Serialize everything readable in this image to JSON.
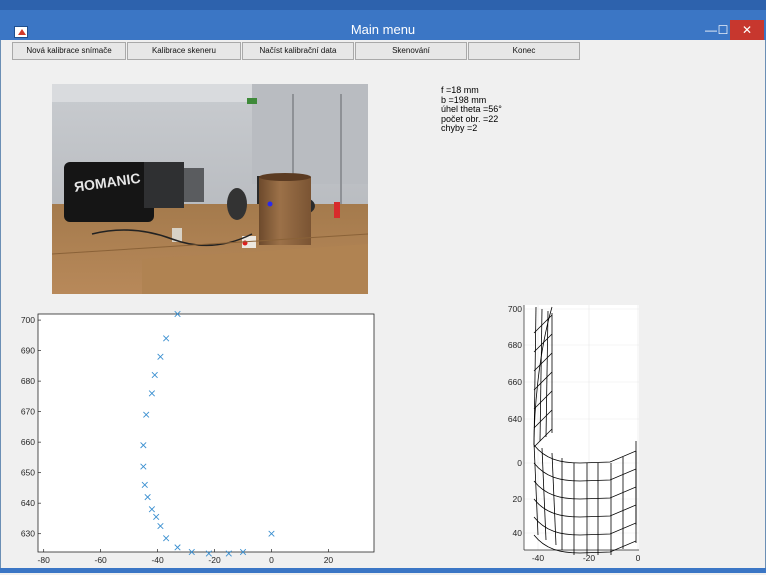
{
  "window": {
    "title": "Main menu",
    "minimize_glyph": "—",
    "maximize_glyph": "☐",
    "close_glyph": "✕",
    "icon": "matlab-icon"
  },
  "toolbar": {
    "buttons": [
      {
        "label": "Nová kalibrace snímače"
      },
      {
        "label": "Kalibrace skeneru"
      },
      {
        "label": "Načíst kalibrační data"
      },
      {
        "label": "Skenování"
      },
      {
        "label": "Konec"
      }
    ]
  },
  "info": {
    "f": "f =18 mm",
    "b": "b =198 mm",
    "theta": "úhel theta =56°",
    "count": "počet obr. =22",
    "errors": "chyby =2"
  },
  "chart_data": [
    {
      "type": "scatter",
      "marker": "x",
      "color": "#3a8fd0",
      "xlim": [
        -82,
        36
      ],
      "ylim": [
        624,
        702
      ],
      "xticks": [
        "-80",
        "-60",
        "-40",
        "-20",
        "0",
        "20"
      ],
      "xtick_values": [
        -80,
        -60,
        -40,
        -20,
        0,
        20
      ],
      "yticks": [
        "630",
        "640",
        "650",
        "660",
        "670",
        "680",
        "690",
        "700"
      ],
      "ytick_values": [
        630,
        640,
        650,
        660,
        670,
        680,
        690,
        700
      ],
      "points": [
        [
          -33,
          702
        ],
        [
          -37,
          694
        ],
        [
          -39,
          688
        ],
        [
          -41,
          682
        ],
        [
          -42,
          676
        ],
        [
          -44,
          669
        ],
        [
          -45,
          659
        ],
        [
          -45,
          652
        ],
        [
          -44.5,
          646
        ],
        [
          -43.5,
          642
        ],
        [
          -42,
          638
        ],
        [
          -40.5,
          635.5
        ],
        [
          -39,
          632.5
        ],
        [
          -37,
          628.5
        ],
        [
          -33,
          625.5
        ],
        [
          -28,
          624
        ],
        [
          -22,
          623.5
        ],
        [
          -15,
          623.5
        ],
        [
          -10,
          624
        ],
        [
          0,
          630
        ]
      ]
    },
    {
      "type": "surface-3d",
      "xticks": [
        "-40",
        "-20",
        "0"
      ],
      "xtick_values": [
        -40,
        -20,
        0
      ],
      "yticks": [
        "700",
        "680",
        "660",
        "640",
        "0",
        "20",
        "40"
      ],
      "ytick_values": [
        700,
        680,
        660,
        640,
        0,
        20,
        40
      ],
      "grid": true
    }
  ]
}
